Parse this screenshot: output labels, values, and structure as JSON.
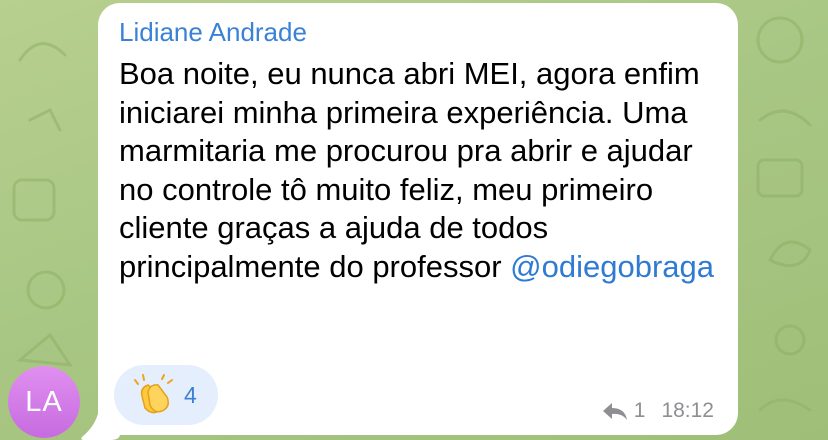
{
  "message": {
    "sender": "Lidiane Andrade",
    "text": "Boa noite, eu nunca abri MEI, agora enfim iniciarei minha primeira experiência. Uma marmitaria me procurou pra abrir e ajudar no controle tô muito feliz, meu primeiro cliente graças a ajuda de todos principalmente do professor",
    "mention": "@odiegobraga",
    "time": "18:12",
    "reply_count": "1"
  },
  "avatar": {
    "initials": "LA",
    "color": "#d37ee8"
  },
  "reaction": {
    "icon": "clapping-hands-icon",
    "count": "4"
  },
  "colors": {
    "background": "#a9c784",
    "sender_name": "#3a82d6",
    "mention": "#2f7bd3",
    "reaction_bg": "#e4eefc",
    "meta": "#8e8e93"
  }
}
